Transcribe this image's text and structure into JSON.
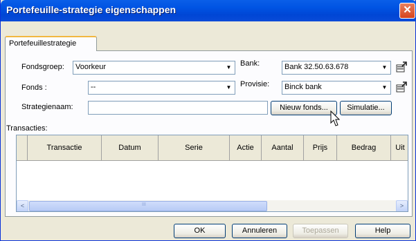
{
  "window": {
    "title": "Portefeuille-strategie eigenschappen",
    "close_symbol": "✕"
  },
  "tab": {
    "label": "Portefeuillestrategie"
  },
  "form": {
    "fondsgroep_label": "Fondsgroep:",
    "fondsgroep_value": "Voorkeur",
    "fonds_label": "Fonds :",
    "fonds_value": "--",
    "strategienaam_label": "Strategienaam:",
    "strategienaam_value": "",
    "bank_label": "Bank:",
    "bank_value": "Bank 32.50.63.678",
    "provisie_label": "Provisie:",
    "provisie_value": "Binck bank",
    "combo_arrow": "▼"
  },
  "buttons": {
    "nieuw_fonds": "Nieuw fonds...",
    "simulatie": "Simulatie...",
    "ok": "OK",
    "annuleren": "Annuleren",
    "toepassen": "Toepassen",
    "help": "Help"
  },
  "transacties": {
    "label": "Transacties:",
    "columns": [
      "",
      "Transactie",
      "Datum",
      "Serie",
      "Actie",
      "Aantal",
      "Prijs",
      "Bedrag",
      "Uit"
    ],
    "scroll_left": "<",
    "scroll_right": ">",
    "thumb_grip": "III"
  }
}
